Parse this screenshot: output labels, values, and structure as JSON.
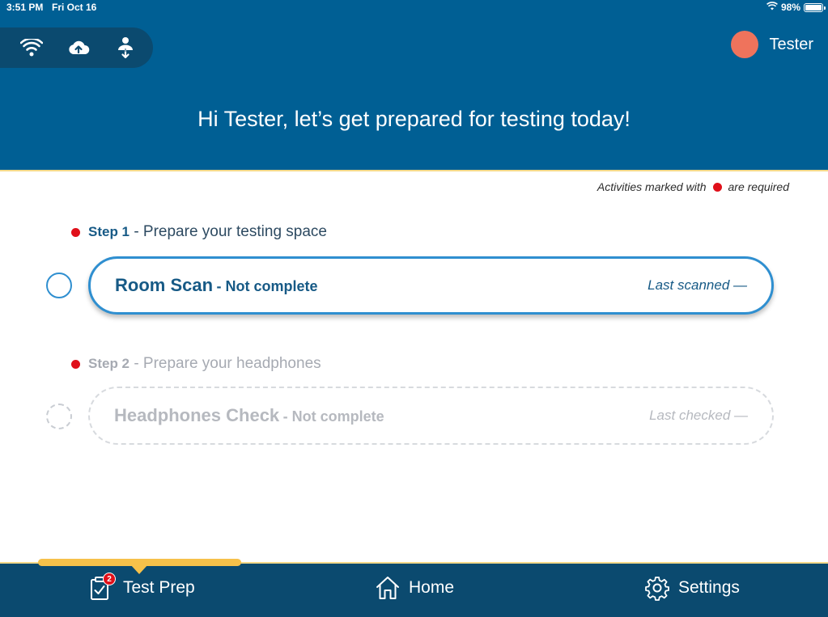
{
  "status_bar": {
    "time": "3:51 PM",
    "date": "Fri Oct 16",
    "battery": "98%",
    "battery_level": 0.98
  },
  "header": {
    "connection_icons": [
      "wifi-icon",
      "cloud-upload-icon",
      "user-download-icon"
    ],
    "user_name": "Tester",
    "avatar_color": "#ef735c",
    "greeting": "Hi Tester, let’s get prepared for testing today!"
  },
  "content": {
    "required_note_prefix": "Activities marked with",
    "required_note_suffix": "are required",
    "steps": [
      {
        "step_num": "Step 1",
        "step_title": "- Prepare your testing space",
        "card_title": "Room Scan",
        "card_status": "- Not complete",
        "card_meta": "Last scanned  —",
        "enabled": true
      },
      {
        "step_num": "Step 2",
        "step_title": "- Prepare your headphones",
        "card_title": "Headphones Check",
        "card_status": "- Not complete",
        "card_meta": "Last checked  —",
        "enabled": false
      }
    ]
  },
  "bottom_nav": {
    "items": [
      {
        "label": "Test Prep",
        "icon": "clipboard-check-icon",
        "badge": "2",
        "active": true
      },
      {
        "label": "Home",
        "icon": "home-icon",
        "active": false
      },
      {
        "label": "Settings",
        "icon": "gear-icon",
        "active": false
      }
    ]
  },
  "colors": {
    "header_bg": "#005f94",
    "nav_bg": "#0b4a6f",
    "accent_blue": "#2f8fd0",
    "indicator_yellow": "#f6c14a",
    "required_red": "#e0101a"
  }
}
